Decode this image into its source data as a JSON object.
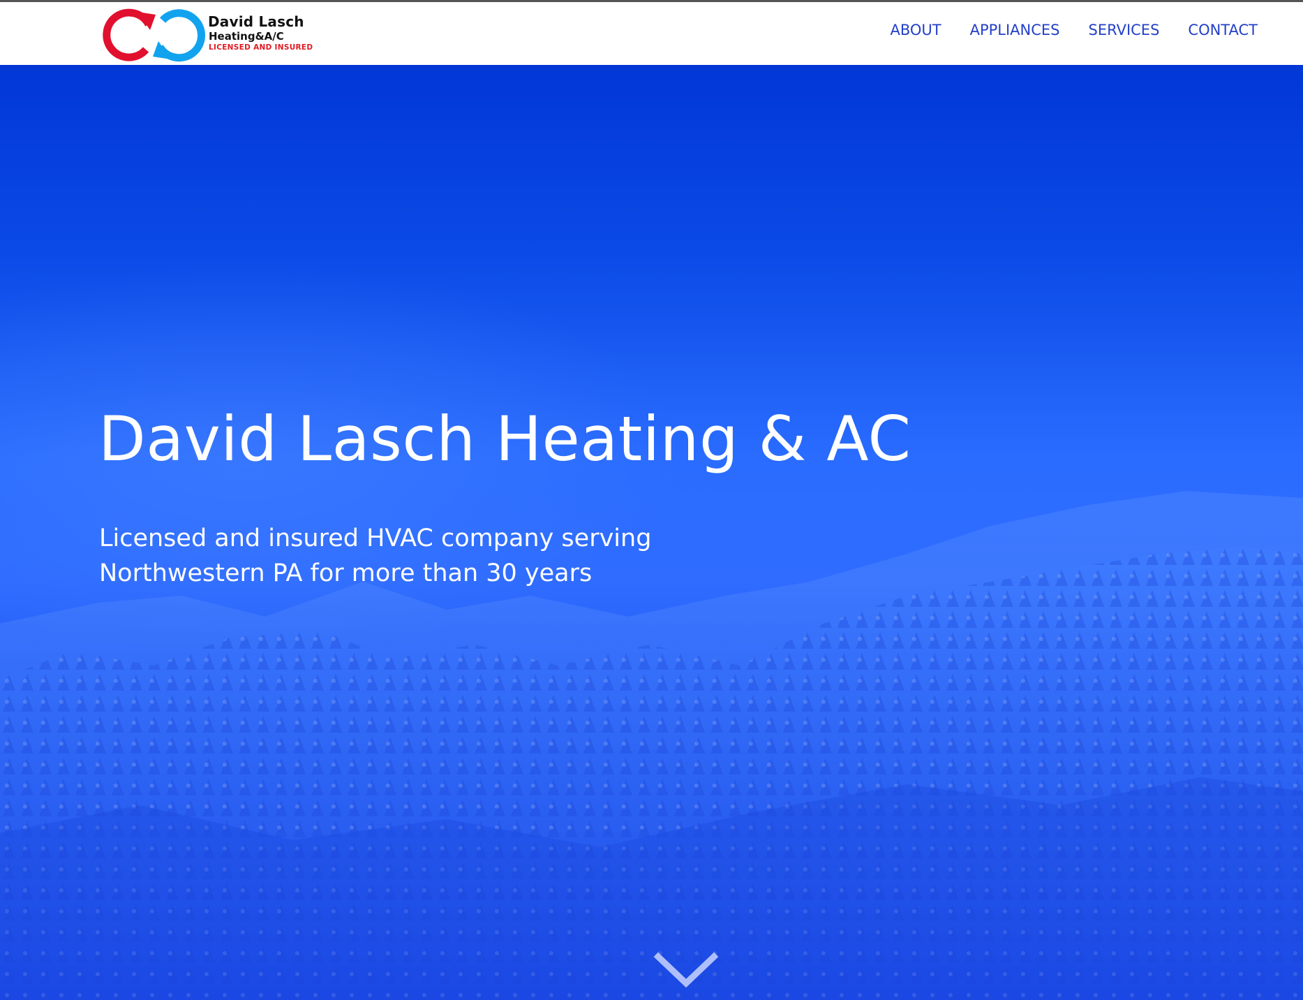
{
  "brand": {
    "name": "David Lasch",
    "subtitle": "Heating&A/C",
    "tagline": "LICENSED AND INSURED",
    "logo_colors": {
      "red_arrow": "#e0102e",
      "blue_arrow": "#12a3ef"
    }
  },
  "nav": {
    "items": [
      {
        "label": "ABOUT"
      },
      {
        "label": "APPLIANCES"
      },
      {
        "label": "SERVICES"
      },
      {
        "label": "CONTACT"
      }
    ],
    "link_color": "#2440c8"
  },
  "hero": {
    "title": "David Lasch Heating & AC",
    "subtitle_line1": "Licensed and insured HVAC company serving",
    "subtitle_line2": "Northwestern PA for more than 30 years",
    "background_color": "#1f5cff",
    "scroll_icon": "chevron-down-icon"
  }
}
